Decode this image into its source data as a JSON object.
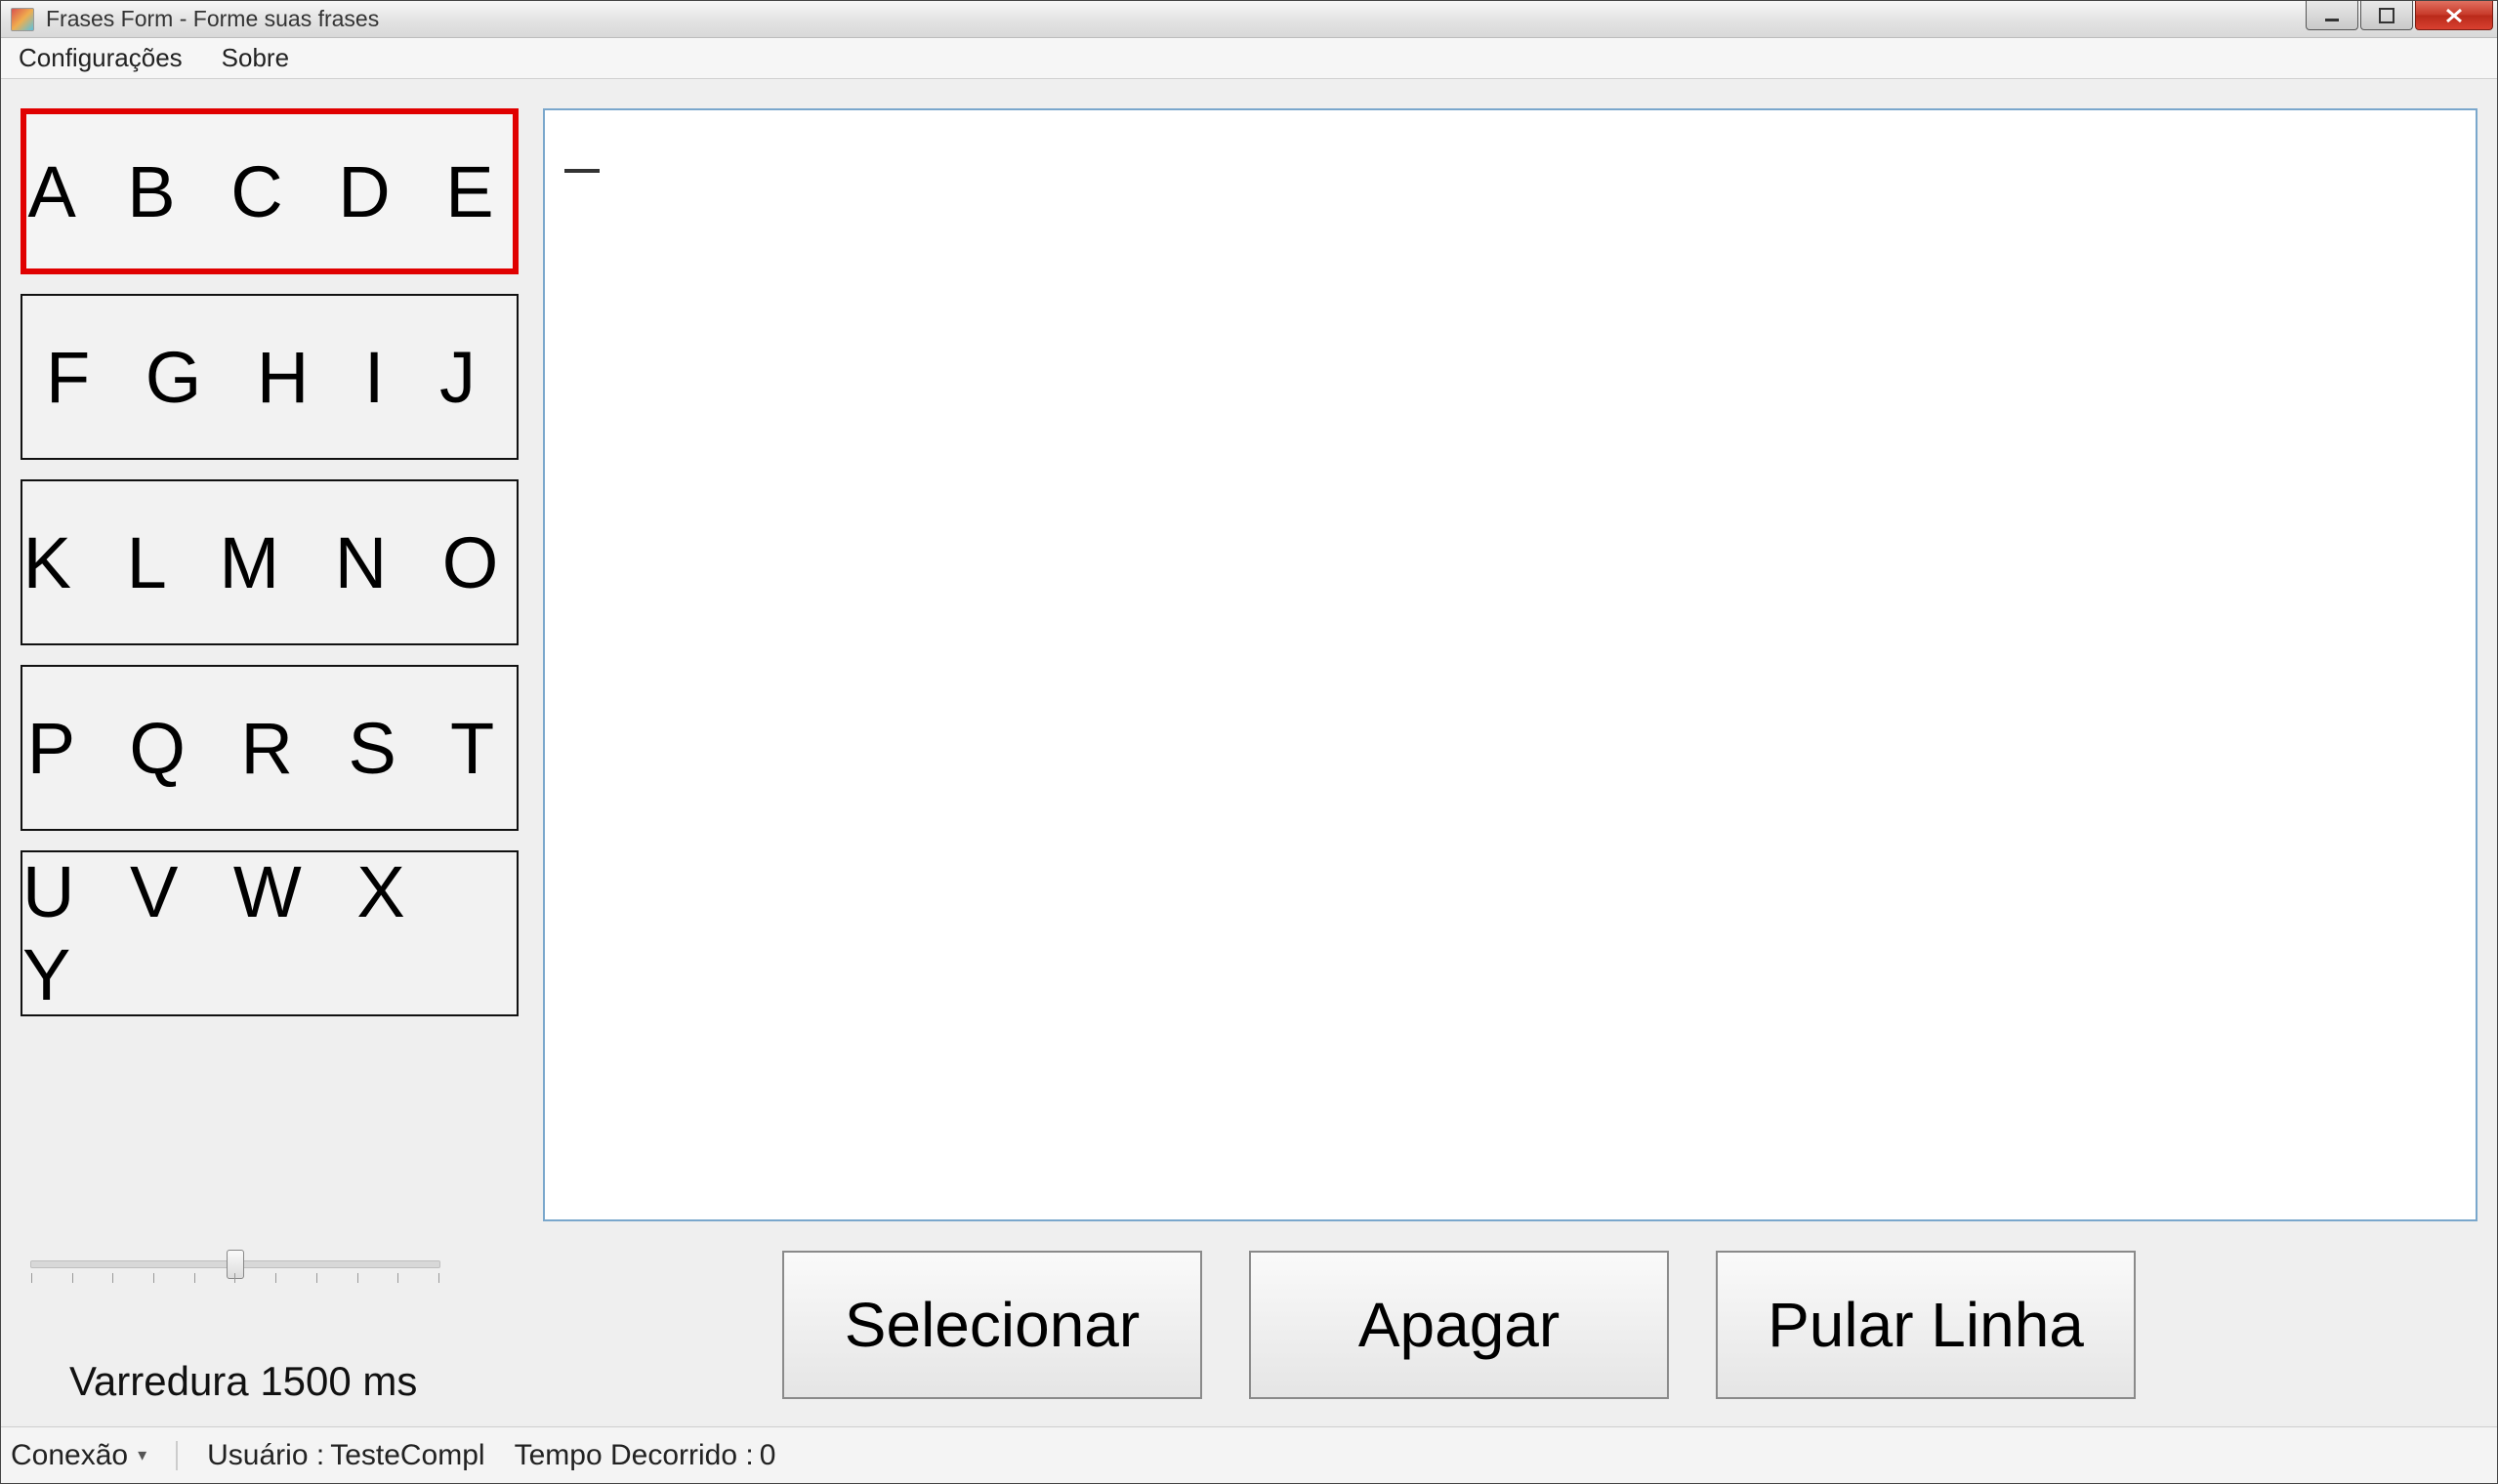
{
  "window": {
    "title": "Frases Form - Forme suas frases"
  },
  "menu": {
    "config": "Configurações",
    "about": "Sobre"
  },
  "letter_groups": {
    "g0": "A B C D E",
    "g1": "F G H I J",
    "g2": "K L M N O",
    "g3": "P Q R S T",
    "g4": "U V W X Y"
  },
  "selected_group_index": 0,
  "text_output": "",
  "slider": {
    "label": "Varredura 1500 ms",
    "value_ms": 1500
  },
  "buttons": {
    "select": "Selecionar",
    "delete": "Apagar",
    "newline": "Pular Linha"
  },
  "status": {
    "connection_label": "Conexão",
    "user_label": "Usuário :",
    "user_value": "TesteCompl",
    "elapsed_label": "Tempo Decorrido :",
    "elapsed_value": "0"
  }
}
